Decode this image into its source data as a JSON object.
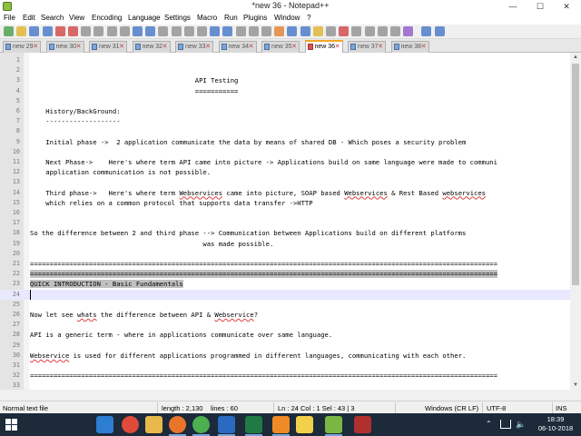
{
  "window": {
    "title": "*new 36 - Notepad++",
    "minimize": "—",
    "maximize": "☐",
    "close": "✕"
  },
  "menu": [
    "File",
    "Edit",
    "Search",
    "View",
    "Encoding",
    "Language",
    "Settings",
    "Macro",
    "Run",
    "Plugins",
    "Window",
    "?"
  ],
  "toolbar": {
    "buttons": [
      "new-file",
      "open-file",
      "save",
      "save-all",
      "close",
      "close-all",
      "print",
      "cut",
      "copy",
      "paste",
      "undo",
      "redo",
      "find",
      "replace",
      "zoom-in",
      "zoom-out",
      "sync-v",
      "sync-h",
      "wrap",
      "show-all",
      "indent-guide",
      "udl",
      "doc-map",
      "function-list",
      "folder-workspace",
      "monitor",
      "record",
      "stop",
      "play",
      "play-multi",
      "save-macro",
      "spellcheck",
      "spellcheck-next",
      "spellcheck-settings"
    ],
    "colors": {
      "green": "#3c9a3c",
      "blue": "#3a6fc4",
      "red": "#d03a3a",
      "yellow": "#e0b020",
      "gray": "#8a8a8a",
      "orange": "#e07a20",
      "purple": "#8a4fc4"
    }
  },
  "tabs": [
    {
      "label": "new 29",
      "active": false
    },
    {
      "label": "new 30",
      "active": false
    },
    {
      "label": "new 31",
      "active": false
    },
    {
      "label": "new 32",
      "active": false
    },
    {
      "label": "new 33",
      "active": false
    },
    {
      "label": "new 34",
      "active": false
    },
    {
      "label": "new 35",
      "active": false
    },
    {
      "label": "new 36",
      "active": true
    },
    {
      "label": "new 37",
      "active": false
    },
    {
      "label": "new 38",
      "active": false
    }
  ],
  "editor": {
    "current_line": 24,
    "lines": [
      {
        "n": "1",
        "segs": []
      },
      {
        "n": "2",
        "segs": []
      },
      {
        "n": "3",
        "segs": [
          {
            "t": "                                          API Testing"
          }
        ]
      },
      {
        "n": "4",
        "segs": [
          {
            "t": "                                          ==========="
          }
        ]
      },
      {
        "n": "5",
        "segs": []
      },
      {
        "n": "6",
        "segs": [
          {
            "t": "    History/BackGround:"
          }
        ]
      },
      {
        "n": "7",
        "segs": [
          {
            "t": "    -------------------"
          }
        ]
      },
      {
        "n": "8",
        "segs": []
      },
      {
        "n": "9",
        "segs": [
          {
            "t": "    Initial phase ->  2 application communicate the data by means of shared DB - Which poses a security problem"
          }
        ]
      },
      {
        "n": "10",
        "segs": []
      },
      {
        "n": "11",
        "segs": [
          {
            "t": "    Next Phase->    Here's where term API came into picture -> Applications build on same language were made to communi"
          }
        ]
      },
      {
        "n": "12",
        "segs": [
          {
            "t": "    application communication is not possible."
          }
        ]
      },
      {
        "n": "13",
        "segs": []
      },
      {
        "n": "14",
        "segs": [
          {
            "t": "    Third phase->   Here's where term "
          },
          {
            "t": "Webservices",
            "s": "spell"
          },
          {
            "t": " came into picture, SOAP based "
          },
          {
            "t": "Webservices",
            "s": "spell"
          },
          {
            "t": " & Rest Based "
          },
          {
            "t": "webservices",
            "s": "spell"
          }
        ]
      },
      {
        "n": "15",
        "segs": [
          {
            "t": "    which relies on a common protocol that supports data transfer ->HTTP"
          }
        ]
      },
      {
        "n": "16",
        "segs": []
      },
      {
        "n": "17",
        "segs": []
      },
      {
        "n": "18",
        "segs": [
          {
            "t": "So the difference between 2 and third phase --> Communication between Applications build on different platforms"
          }
        ]
      },
      {
        "n": "19",
        "segs": [
          {
            "t": "                                            was made possible."
          }
        ]
      },
      {
        "n": "20",
        "segs": []
      },
      {
        "n": "21",
        "segs": [
          {
            "t": "======================================================================================================================="
          }
        ]
      },
      {
        "n": "22",
        "segs": [
          {
            "t": "=======================================================================================================================",
            "s": "sel"
          }
        ]
      },
      {
        "n": "23",
        "segs": [
          {
            "t": "QUICK INTRODUCTION - Basic Fundamentals",
            "s": "sel"
          }
        ]
      },
      {
        "n": "24",
        "segs": []
      },
      {
        "n": "25",
        "segs": []
      },
      {
        "n": "26",
        "segs": [
          {
            "t": "Now let see "
          },
          {
            "t": "whats",
            "s": "spell"
          },
          {
            "t": " the difference between API & "
          },
          {
            "t": "Webservice",
            "s": "spell"
          },
          {
            "t": "?"
          }
        ]
      },
      {
        "n": "27",
        "segs": []
      },
      {
        "n": "28",
        "segs": [
          {
            "t": "API is a generic term - where in applications communicate over same language."
          }
        ]
      },
      {
        "n": "29",
        "segs": []
      },
      {
        "n": "30",
        "segs": [
          {
            "t": "Webservice",
            "s": "spell"
          },
          {
            "t": " is used for different applications programmed in different languages, communicating with each other."
          }
        ]
      },
      {
        "n": "31",
        "segs": []
      },
      {
        "n": "32",
        "segs": [
          {
            "t": "======================================================================================================================="
          }
        ]
      },
      {
        "n": "33",
        "segs": []
      }
    ]
  },
  "status": {
    "type": "Normal text file",
    "length": "length : 2,130",
    "lines": "lines : 60",
    "position": "Ln : 24   Col : 1   Sel : 43 | 3",
    "eol": "Windows (CR LF)",
    "encoding": "UTF-8",
    "mode": "INS"
  },
  "taskbar": {
    "apps": [
      {
        "name": "cortana",
        "color": "#1c2a3a"
      },
      {
        "name": "task-view",
        "color": "#1c2a3a"
      },
      {
        "name": "edge",
        "color": "#2d7dd2"
      },
      {
        "name": "screen-recorder",
        "color": "#e04a3a"
      },
      {
        "name": "file-explorer",
        "color": "#e8b84a"
      },
      {
        "name": "firefox",
        "color": "#e8742a"
      },
      {
        "name": "chrome",
        "color": "#4caf50"
      },
      {
        "name": "outlook",
        "color": "#2a6ac0"
      },
      {
        "name": "excel",
        "color": "#1f7a43"
      },
      {
        "name": "sublime",
        "color": "#f08a24"
      },
      {
        "name": "sticky-notes",
        "color": "#f2d04a"
      },
      {
        "name": "notepad-plus-plus",
        "color": "#79b742"
      },
      {
        "name": "snipping-tool",
        "color": "#b03030"
      }
    ],
    "time": "18:39",
    "date": "06-10-2018"
  }
}
